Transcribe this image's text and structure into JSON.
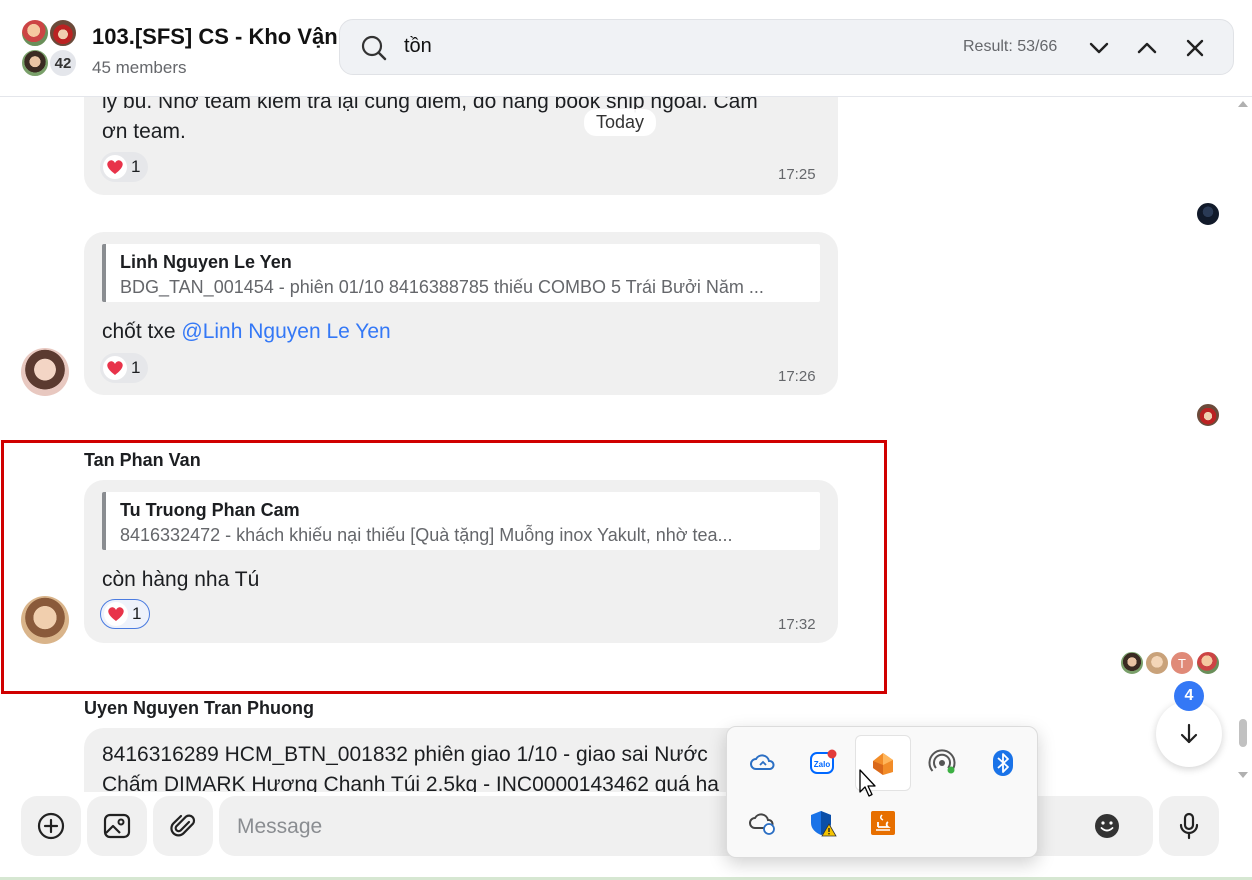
{
  "header": {
    "title": "103.[SFS] CS - Kho Vận",
    "subtitle": "45 members",
    "avatar_count": "42"
  },
  "search": {
    "query": "tồn",
    "result": "Result: 53/66"
  },
  "chat": {
    "date_divider": "Today",
    "messages": [
      {
        "text_line1": "ly bù. Nhờ team kiểm tra lại cùng điểm, do hàng book ship ngoài. Cảm",
        "text_line2": "ơn team.",
        "reaction_count": "1",
        "time": "17:25"
      },
      {
        "quote_name": "Linh Nguyen Le Yen",
        "quote_text": "BDG_TAN_001454 - phiên 01/10 8416388785 thiếu COMBO 5 Trái Bưởi Năm ...",
        "text": "chốt txe ",
        "mention": "@Linh Nguyen Le Yen",
        "reaction_count": "1",
        "time": "17:26"
      },
      {
        "sender": "Tan Phan Van",
        "quote_name": "Tu Truong Phan Cam",
        "quote_text": "8416332472 - khách khiếu nại thiếu [Quà tặng] Muỗng inox Yakult, nhờ tea...",
        "text": "còn hàng nha Tú",
        "reaction_count": "1",
        "time": "17:32"
      },
      {
        "sender": "Uyen Nguyen Tran Phuong",
        "text_line1": "8416316289 HCM_BTN_001832 phiên giao 1/10 - giao sai Nước",
        "text_line2": "Chấm DIMARK Hương Chanh Túi 2.5kg - INC0000143462 quá hạ"
      }
    ],
    "seen_letter": "T",
    "unread_count": "4"
  },
  "composer": {
    "placeholder": "Message"
  },
  "tray": {
    "items": [
      "onedrive-cloud-icon",
      "zalo-icon",
      "app-orange-icon",
      "wireless-icon",
      "bluetooth-icon",
      "onedrive-sync-icon",
      "security-warning-icon",
      "java-icon"
    ]
  },
  "colors": {
    "accent": "#3478f6",
    "highlight_border": "#d00000",
    "bubble": "#f0f0f0",
    "heart": "#e8334a"
  }
}
